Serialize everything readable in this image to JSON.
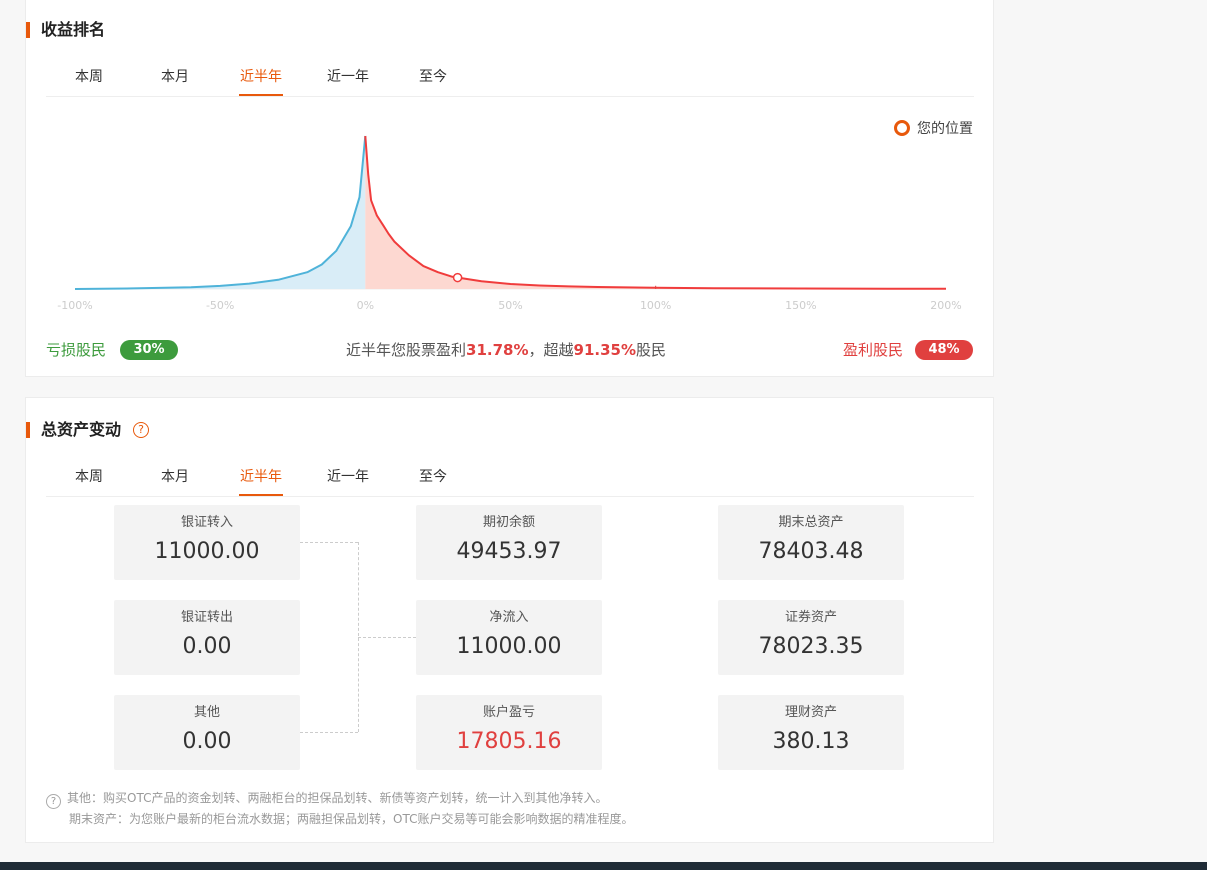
{
  "ranking": {
    "title": "收益排名",
    "tabs": [
      "本周",
      "本月",
      "近半年",
      "近一年",
      "至今"
    ],
    "active_tab": "近半年",
    "legend": "您的位置",
    "loss_label": "亏损股民",
    "loss_pct": "30%",
    "profit_label": "盈利股民",
    "profit_pct": "48%",
    "summary_prefix": "近半年您股票盈利",
    "summary_return": "31.78%",
    "summary_mid": "，超越",
    "summary_beat": "91.35%",
    "summary_suffix": "股民",
    "colors": {
      "loss": "#3d9b3d",
      "profit": "#e0403f",
      "accent": "#e8590c"
    }
  },
  "chart_data": {
    "type": "area",
    "xlabel": "",
    "ylabel": "",
    "x_ticks": [
      "-100%",
      "-50%",
      "0%",
      "50%",
      "100%",
      "150%",
      "200%"
    ],
    "xlim": [
      -100,
      200
    ],
    "x": [
      -100,
      -80,
      -60,
      -50,
      -40,
      -30,
      -20,
      -15,
      -10,
      -5,
      -2,
      0,
      1,
      2,
      4,
      6,
      8,
      10,
      15,
      20,
      25,
      30,
      40,
      50,
      60,
      70,
      80,
      100,
      120,
      150,
      180,
      200
    ],
    "values": [
      0.0,
      0.4,
      1.2,
      2.0,
      3.5,
      6.0,
      11,
      16,
      25,
      41,
      60,
      100,
      75,
      58,
      48,
      42,
      36,
      31,
      22,
      15,
      11,
      8,
      5,
      3.3,
      2.3,
      1.7,
      1.3,
      0.8,
      0.5,
      0.3,
      0.2,
      0.1
    ],
    "series": [
      {
        "name": "亏损股民",
        "color": "#4fb3d9",
        "fill": "#d9edf7",
        "range": [
          -100,
          0
        ]
      },
      {
        "name": "盈利股民",
        "color": "#f03c3c",
        "fill": "#fdd8d1",
        "range": [
          0,
          200
        ]
      }
    ],
    "marker": {
      "label": "您的位置",
      "x": 31.78
    },
    "grid": false
  },
  "assets": {
    "title": "总资产变动",
    "tabs": [
      "本周",
      "本月",
      "近半年",
      "近一年",
      "至今"
    ],
    "active_tab": "近半年",
    "help_icon": "?",
    "in_label": "银证转入",
    "in_value": "11000.00",
    "out_label": "银证转出",
    "out_value": "0.00",
    "other_label": "其他",
    "other_value": "0.00",
    "start_label": "期初余额",
    "start_value": "49453.97",
    "net_label": "净流入",
    "net_value": "11000.00",
    "pl_label": "账户盈亏",
    "pl_value": "17805.16",
    "end_label": "期末总资产",
    "end_value": "78403.48",
    "sec_label": "证券资产",
    "sec_value": "78023.35",
    "wm_label": "理财资产",
    "wm_value": "380.13",
    "note1": "其他：购买OTC产品的资金划转、两融柜台的担保品划转、新债等资产划转，统一计入到其他净转入。",
    "note2": "期末资产：为您账户最新的柜台流水数据；两融担保品划转，OTC账户交易等可能会影响数据的精准程度。"
  }
}
